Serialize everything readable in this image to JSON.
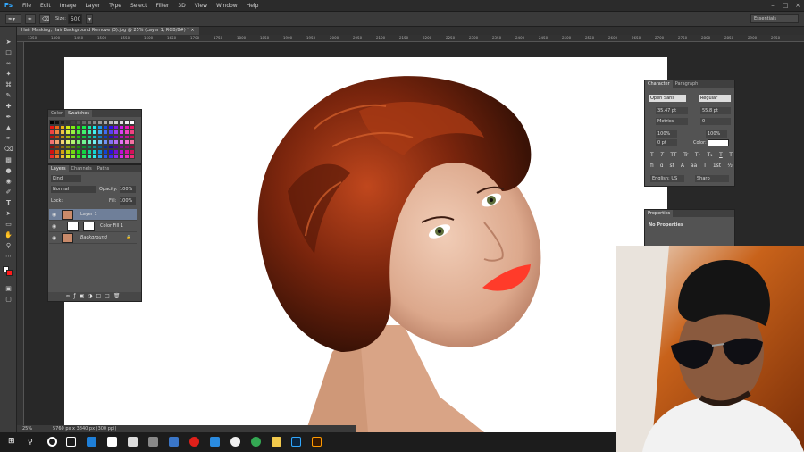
{
  "app": {
    "logo": "Ps"
  },
  "menu": [
    "File",
    "Edit",
    "Image",
    "Layer",
    "Type",
    "Select",
    "Filter",
    "3D",
    "View",
    "Window",
    "Help"
  ],
  "options": {
    "size_label": "Size:",
    "size_value": "500",
    "workspace": "Essentials"
  },
  "document": {
    "tab_title": "Hair Masking, Hair Background Remove (3).jpg @ 25% (Layer 1, RGB/8#) *  ×"
  },
  "ruler": [
    "1350",
    "1400",
    "1450",
    "1500",
    "1550",
    "1600",
    "1650",
    "1700",
    "1750",
    "1800",
    "1850",
    "1900",
    "1950",
    "2000",
    "2050",
    "2100",
    "2150",
    "2200",
    "2250",
    "2300",
    "2350",
    "2400",
    "2450",
    "2500",
    "2550",
    "2600",
    "2650",
    "2700",
    "2750",
    "2800",
    "2850",
    "2900",
    "2950"
  ],
  "swatches_panel": {
    "tabs": [
      "Color",
      "Swatches"
    ],
    "active": "Swatches"
  },
  "layers_panel": {
    "tabs": [
      "Layers",
      "Channels",
      "Paths"
    ],
    "kind": "Kind",
    "blend_mode": "Normal",
    "opacity_label": "Opacity:",
    "opacity_value": "100%",
    "lock_label": "Lock:",
    "fill_label": "Fill:",
    "fill_value": "100%",
    "layers": [
      {
        "name": "Layer 1",
        "selected": true
      },
      {
        "name": "Color Fill 1",
        "selected": false
      },
      {
        "name": "Background",
        "selected": false
      }
    ]
  },
  "character_panel": {
    "tabs": [
      "Character",
      "Paragraph"
    ],
    "font_family": "Open Sans",
    "font_style": "Regular",
    "size1": "35.47 pt",
    "size2": "55.8 pt",
    "tracking_kind": "Metrics",
    "tracking": "0",
    "scale_v": "100%",
    "scale_h": "100%",
    "baseline": "0 pt",
    "color_label": "Color:",
    "type_buttons": [
      "T",
      "T",
      "TT",
      "Tr",
      "T¹",
      "T₁",
      "T",
      "T"
    ],
    "extra_buttons": [
      "fi",
      "ɑ",
      "st",
      "A",
      "aa",
      "T",
      "1st",
      "½"
    ],
    "language": "English: US",
    "antialias": "Sharp"
  },
  "properties_panel": {
    "title": "Properties",
    "body": "No Properties"
  },
  "status": {
    "zoom": "25%",
    "doc_size": "5760 px x 3840 px (300 ppi)"
  },
  "taskbar": {
    "icons": [
      "start-icon",
      "search-icon",
      "cortana-icon",
      "task-view-icon",
      "edge-icon",
      "store-icon",
      "mail-icon",
      "calculator-icon",
      "people-icon",
      "opera-icon",
      "network-icon",
      "chrome-icon",
      "explorer-icon",
      "photoshop-icon",
      "illustrator-icon"
    ]
  }
}
